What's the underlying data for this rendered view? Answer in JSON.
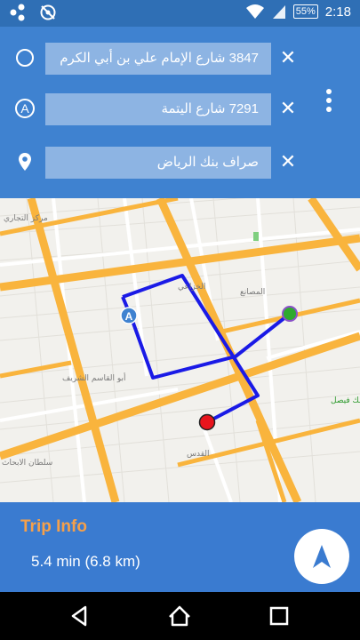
{
  "status_bar": {
    "battery": "55%",
    "time": "2:18",
    "icons": [
      "share-nodes-icon",
      "no-sync-icon",
      "wifi-icon",
      "cell-signal-icon",
      "battery-icon"
    ]
  },
  "route": {
    "origin": "3847 شارع الإمام علي بن أبي الكرم",
    "waypoint_marker": "A",
    "waypoint": "7291 شارع اليتمة",
    "destination": "صراف بنك الرياض",
    "clear_glyph": "✕"
  },
  "map": {
    "labels": {
      "top_left": "مركز التجاري",
      "upper_center": "الخزاعي",
      "right_mid": "المصانع",
      "left_mid": "أبو القاسم الشريف",
      "bottom_center": "القدس",
      "bottom_right": "الملك فيصل",
      "bottom_left": "سلطان الابحاث"
    },
    "route_color": "#1a1ae6",
    "start_marker_color": "#2eaa2e",
    "end_marker_color": "#e8141c",
    "waypoint_marker_color": "#3f82d0"
  },
  "trip": {
    "title": "Trip Info",
    "stats": "5.4 min  (6.8 km)",
    "accent_color": "#f5a04a"
  },
  "nav_bar": {
    "icons": [
      "back-icon",
      "home-icon",
      "recent-apps-icon"
    ]
  }
}
